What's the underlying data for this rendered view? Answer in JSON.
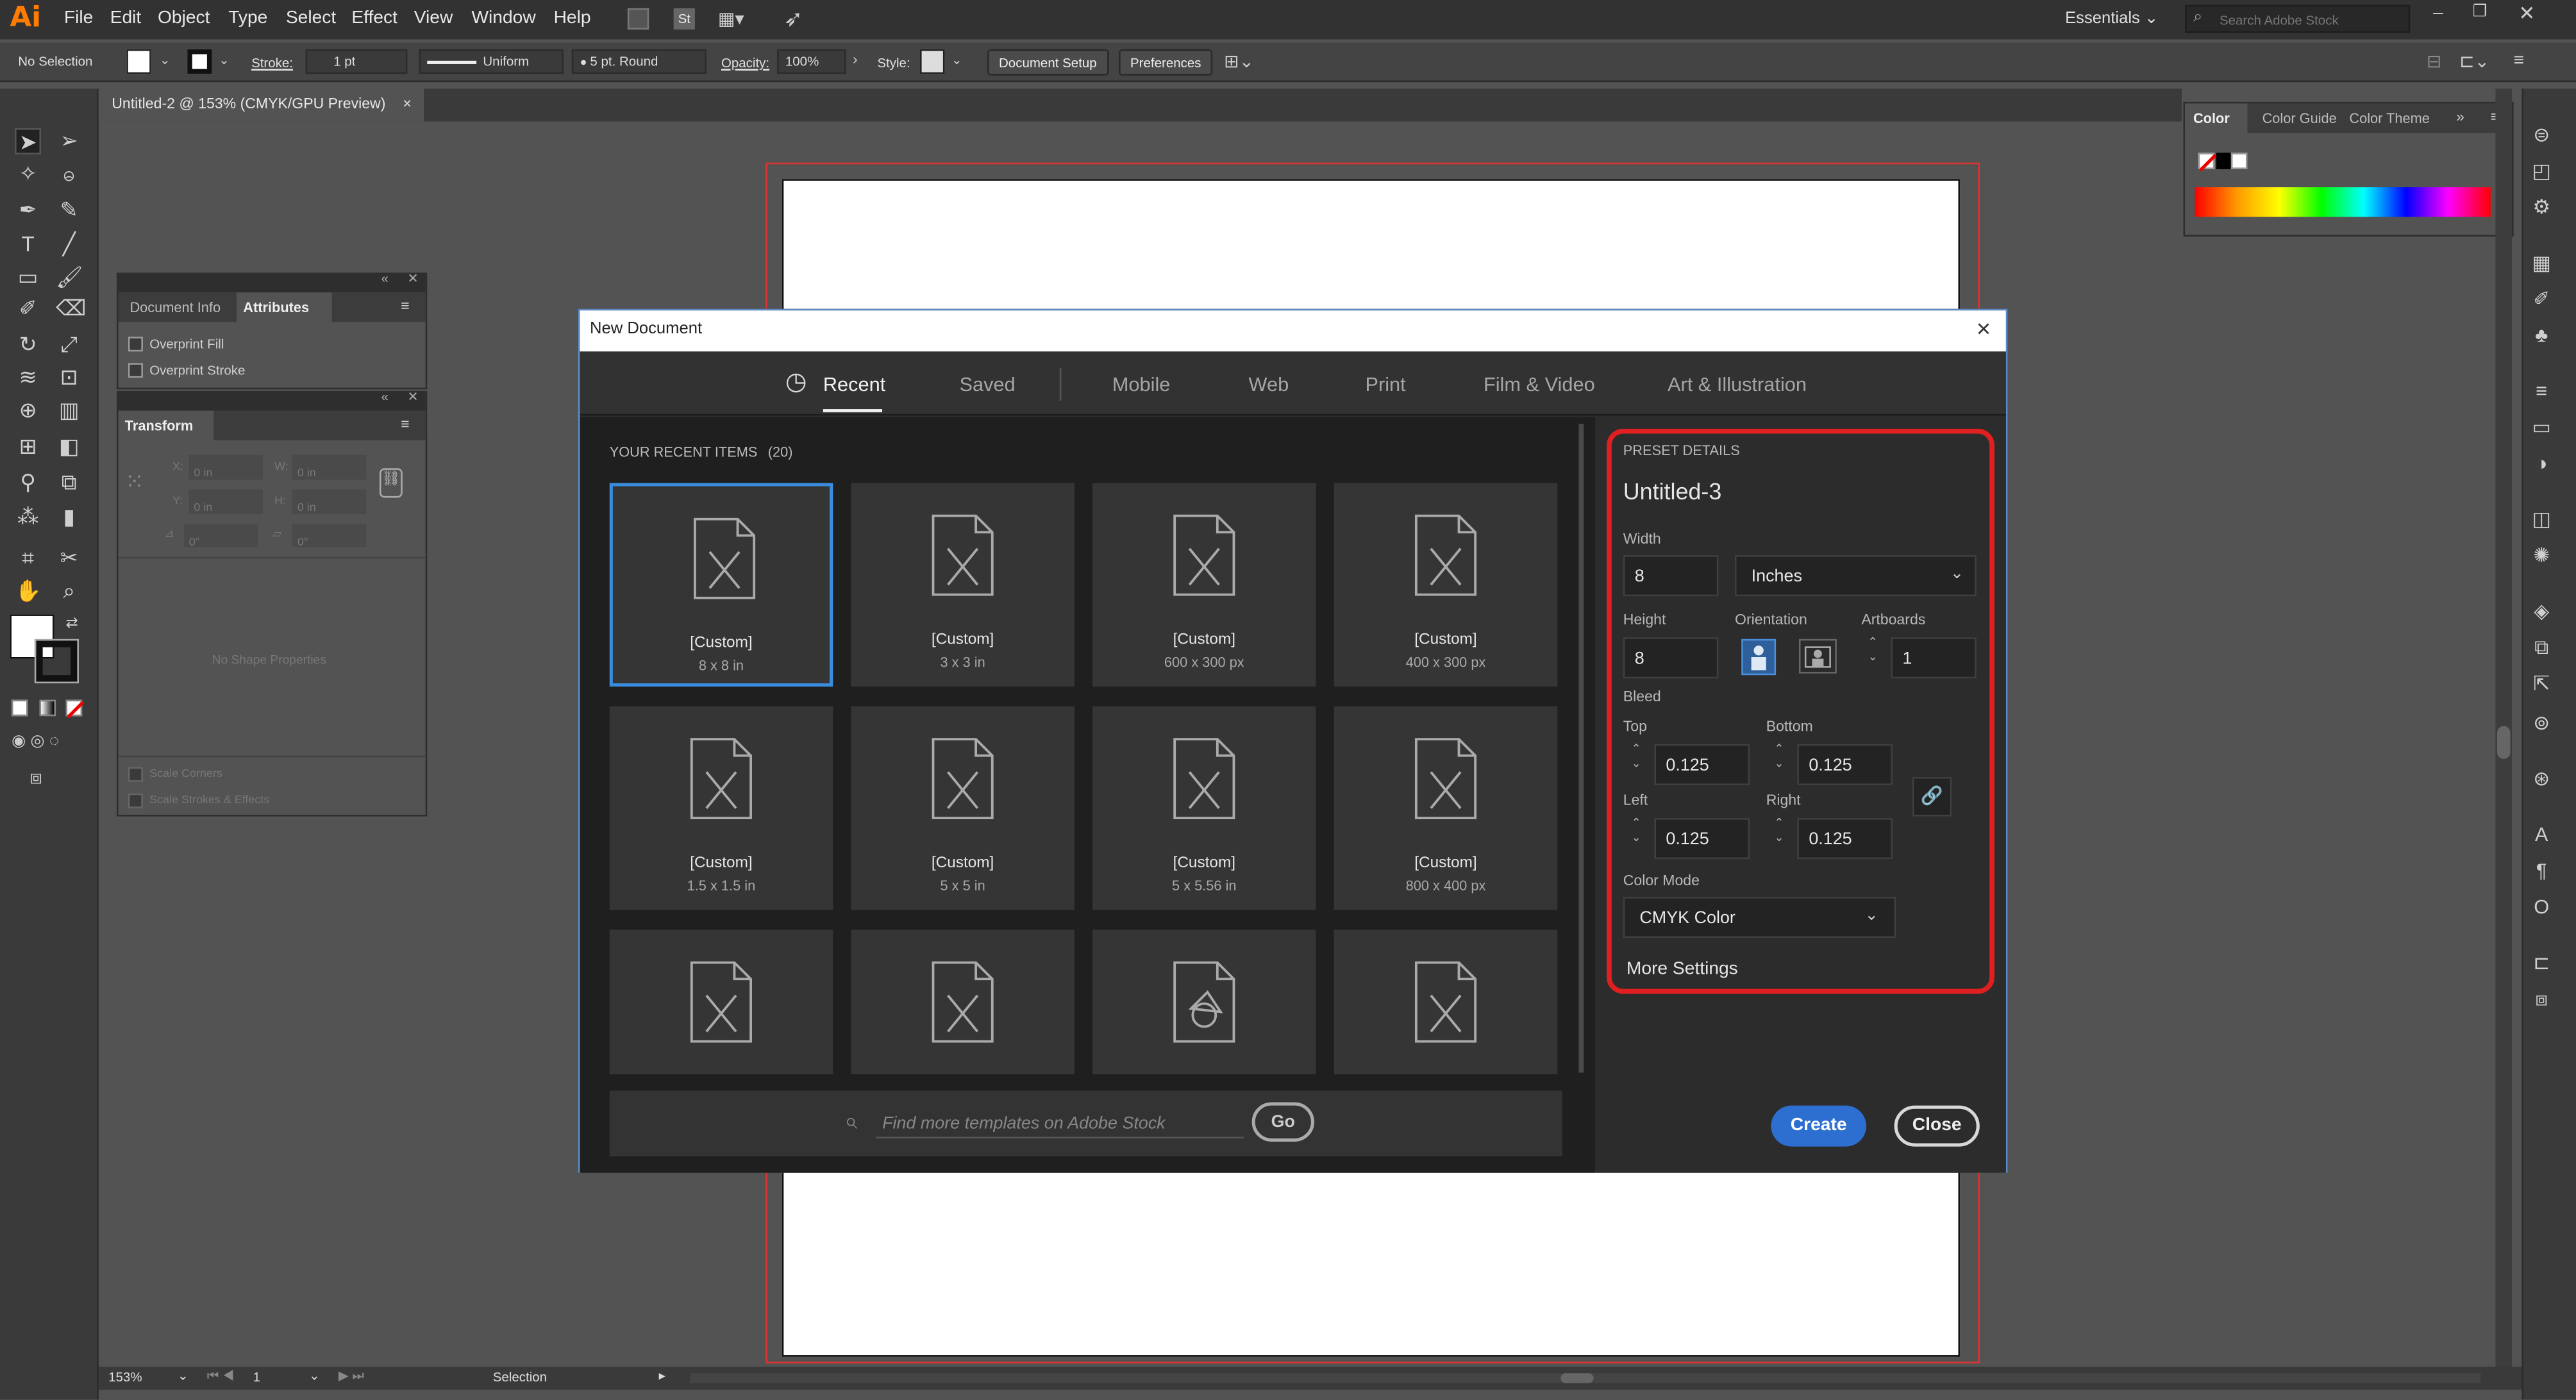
{
  "app": {
    "logo": "Ai",
    "menus": [
      "File",
      "Edit",
      "Object",
      "Type",
      "Select",
      "Effect",
      "View",
      "Window",
      "Help"
    ],
    "workspace": "Essentials",
    "search_placeholder": "Search Adobe Stock"
  },
  "control_bar": {
    "selection": "No Selection",
    "stroke_label": "Stroke:",
    "stroke_value": "1 pt",
    "stroke_style": "Uniform",
    "brush": "5 pt. Round",
    "opacity_label": "Opacity:",
    "opacity_value": "100%",
    "style_label": "Style:",
    "doc_setup": "Document Setup",
    "preferences": "Preferences"
  },
  "document_tab": {
    "title": "Untitled-2 @ 153% (CMYK/GPU Preview)",
    "close": "×"
  },
  "attributes_panel": {
    "tab_doc_info": "Document Info",
    "tab_attributes": "Attributes",
    "overprint_fill": "Overprint Fill",
    "overprint_stroke": "Overprint Stroke"
  },
  "transform_panel": {
    "title": "Transform",
    "x_label": "X:",
    "x_value": "0 in",
    "y_label": "Y:",
    "y_value": "0 in",
    "w_label": "W:",
    "w_value": "0 in",
    "h_label": "H:",
    "h_value": "0 in",
    "angle_value": "0°",
    "shear_value": "0°",
    "no_shape": "No Shape Properties",
    "scale_corners": "Scale Corners",
    "scale_strokes": "Scale Strokes & Effects"
  },
  "color_panel": {
    "tab_color": "Color",
    "tab_guide": "Color Guide",
    "tab_themes": "Color Theme"
  },
  "status": {
    "zoom": "153%",
    "artboard": "1",
    "tool": "Selection"
  },
  "dialog": {
    "title": "New Document",
    "close": "×",
    "tabs": [
      {
        "label": "Recent",
        "active": true
      },
      {
        "label": "Saved",
        "active": false
      },
      {
        "label": "Mobile",
        "active": false
      },
      {
        "label": "Web",
        "active": false
      },
      {
        "label": "Print",
        "active": false
      },
      {
        "label": "Film & Video",
        "active": false
      },
      {
        "label": "Art & Illustration",
        "active": false
      }
    ],
    "recent_header": "YOUR RECENT ITEMS",
    "recent_count": "(20)",
    "items": [
      {
        "title": "[Custom]",
        "size": "8 x 8 in",
        "selected": true
      },
      {
        "title": "[Custom]",
        "size": "3 x 3 in",
        "selected": false
      },
      {
        "title": "[Custom]",
        "size": "600 x 300 px",
        "selected": false
      },
      {
        "title": "[Custom]",
        "size": "400 x 300 px",
        "selected": false
      },
      {
        "title": "[Custom]",
        "size": "1.5 x 1.5 in",
        "selected": false
      },
      {
        "title": "[Custom]",
        "size": "5 x 5 in",
        "selected": false
      },
      {
        "title": "[Custom]",
        "size": "5 x 5.56 in",
        "selected": false
      },
      {
        "title": "[Custom]",
        "size": "800 x 400 px",
        "selected": false
      }
    ],
    "search_placeholder": "Find more templates on Adobe Stock",
    "go": "Go",
    "preset": {
      "header": "PRESET DETAILS",
      "name": "Untitled-3",
      "width_label": "Width",
      "width_value": "8",
      "units": "Inches",
      "height_label": "Height",
      "height_value": "8",
      "orientation_label": "Orientation",
      "artboards_label": "Artboards",
      "artboards_value": "1",
      "bleed_label": "Bleed",
      "top_label": "Top",
      "top_value": "0.125",
      "bottom_label": "Bottom",
      "bottom_value": "0.125",
      "left_label": "Left",
      "left_value": "0.125",
      "right_label": "Right",
      "right_value": "0.125",
      "color_mode_label": "Color Mode",
      "color_mode_value": "CMYK Color",
      "more_settings": "More Settings"
    },
    "create": "Create",
    "close_button": "Close"
  },
  "colors": {
    "accent": "#2d6fd0",
    "highlight": "#e02020",
    "app_bg": "#535353"
  }
}
